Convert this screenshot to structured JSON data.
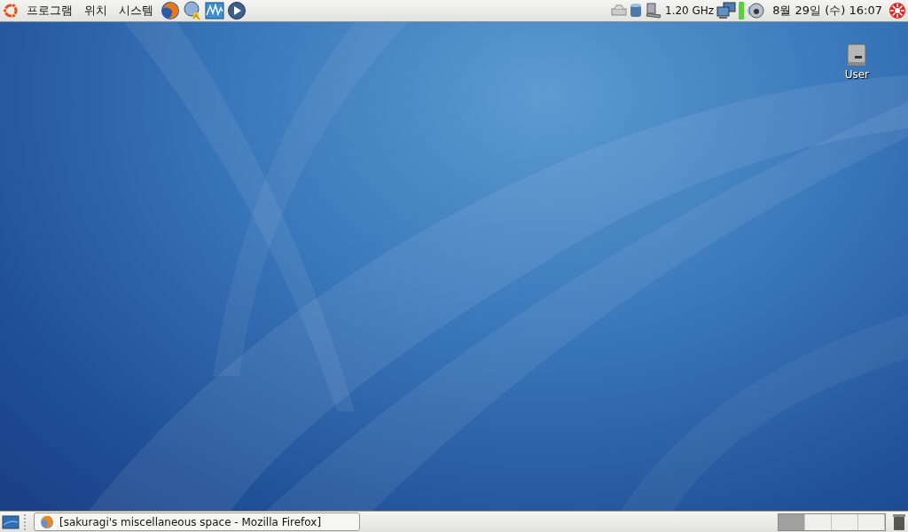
{
  "top_panel": {
    "menus": [
      "프로그램",
      "위치",
      "시스템"
    ],
    "cpu_freq": "1.20 GHz",
    "clock": "8월 29일 (수) 16:07"
  },
  "desktop": {
    "icons": [
      {
        "label": "User"
      }
    ]
  },
  "bottom_panel": {
    "tasks": [
      {
        "label": "[sakuragi's miscellaneous space - Mozilla Firefox]",
        "selected": false
      }
    ],
    "workspaces": [
      {
        "selected": true
      },
      {
        "selected": false
      },
      {
        "selected": false
      },
      {
        "selected": false
      }
    ]
  }
}
